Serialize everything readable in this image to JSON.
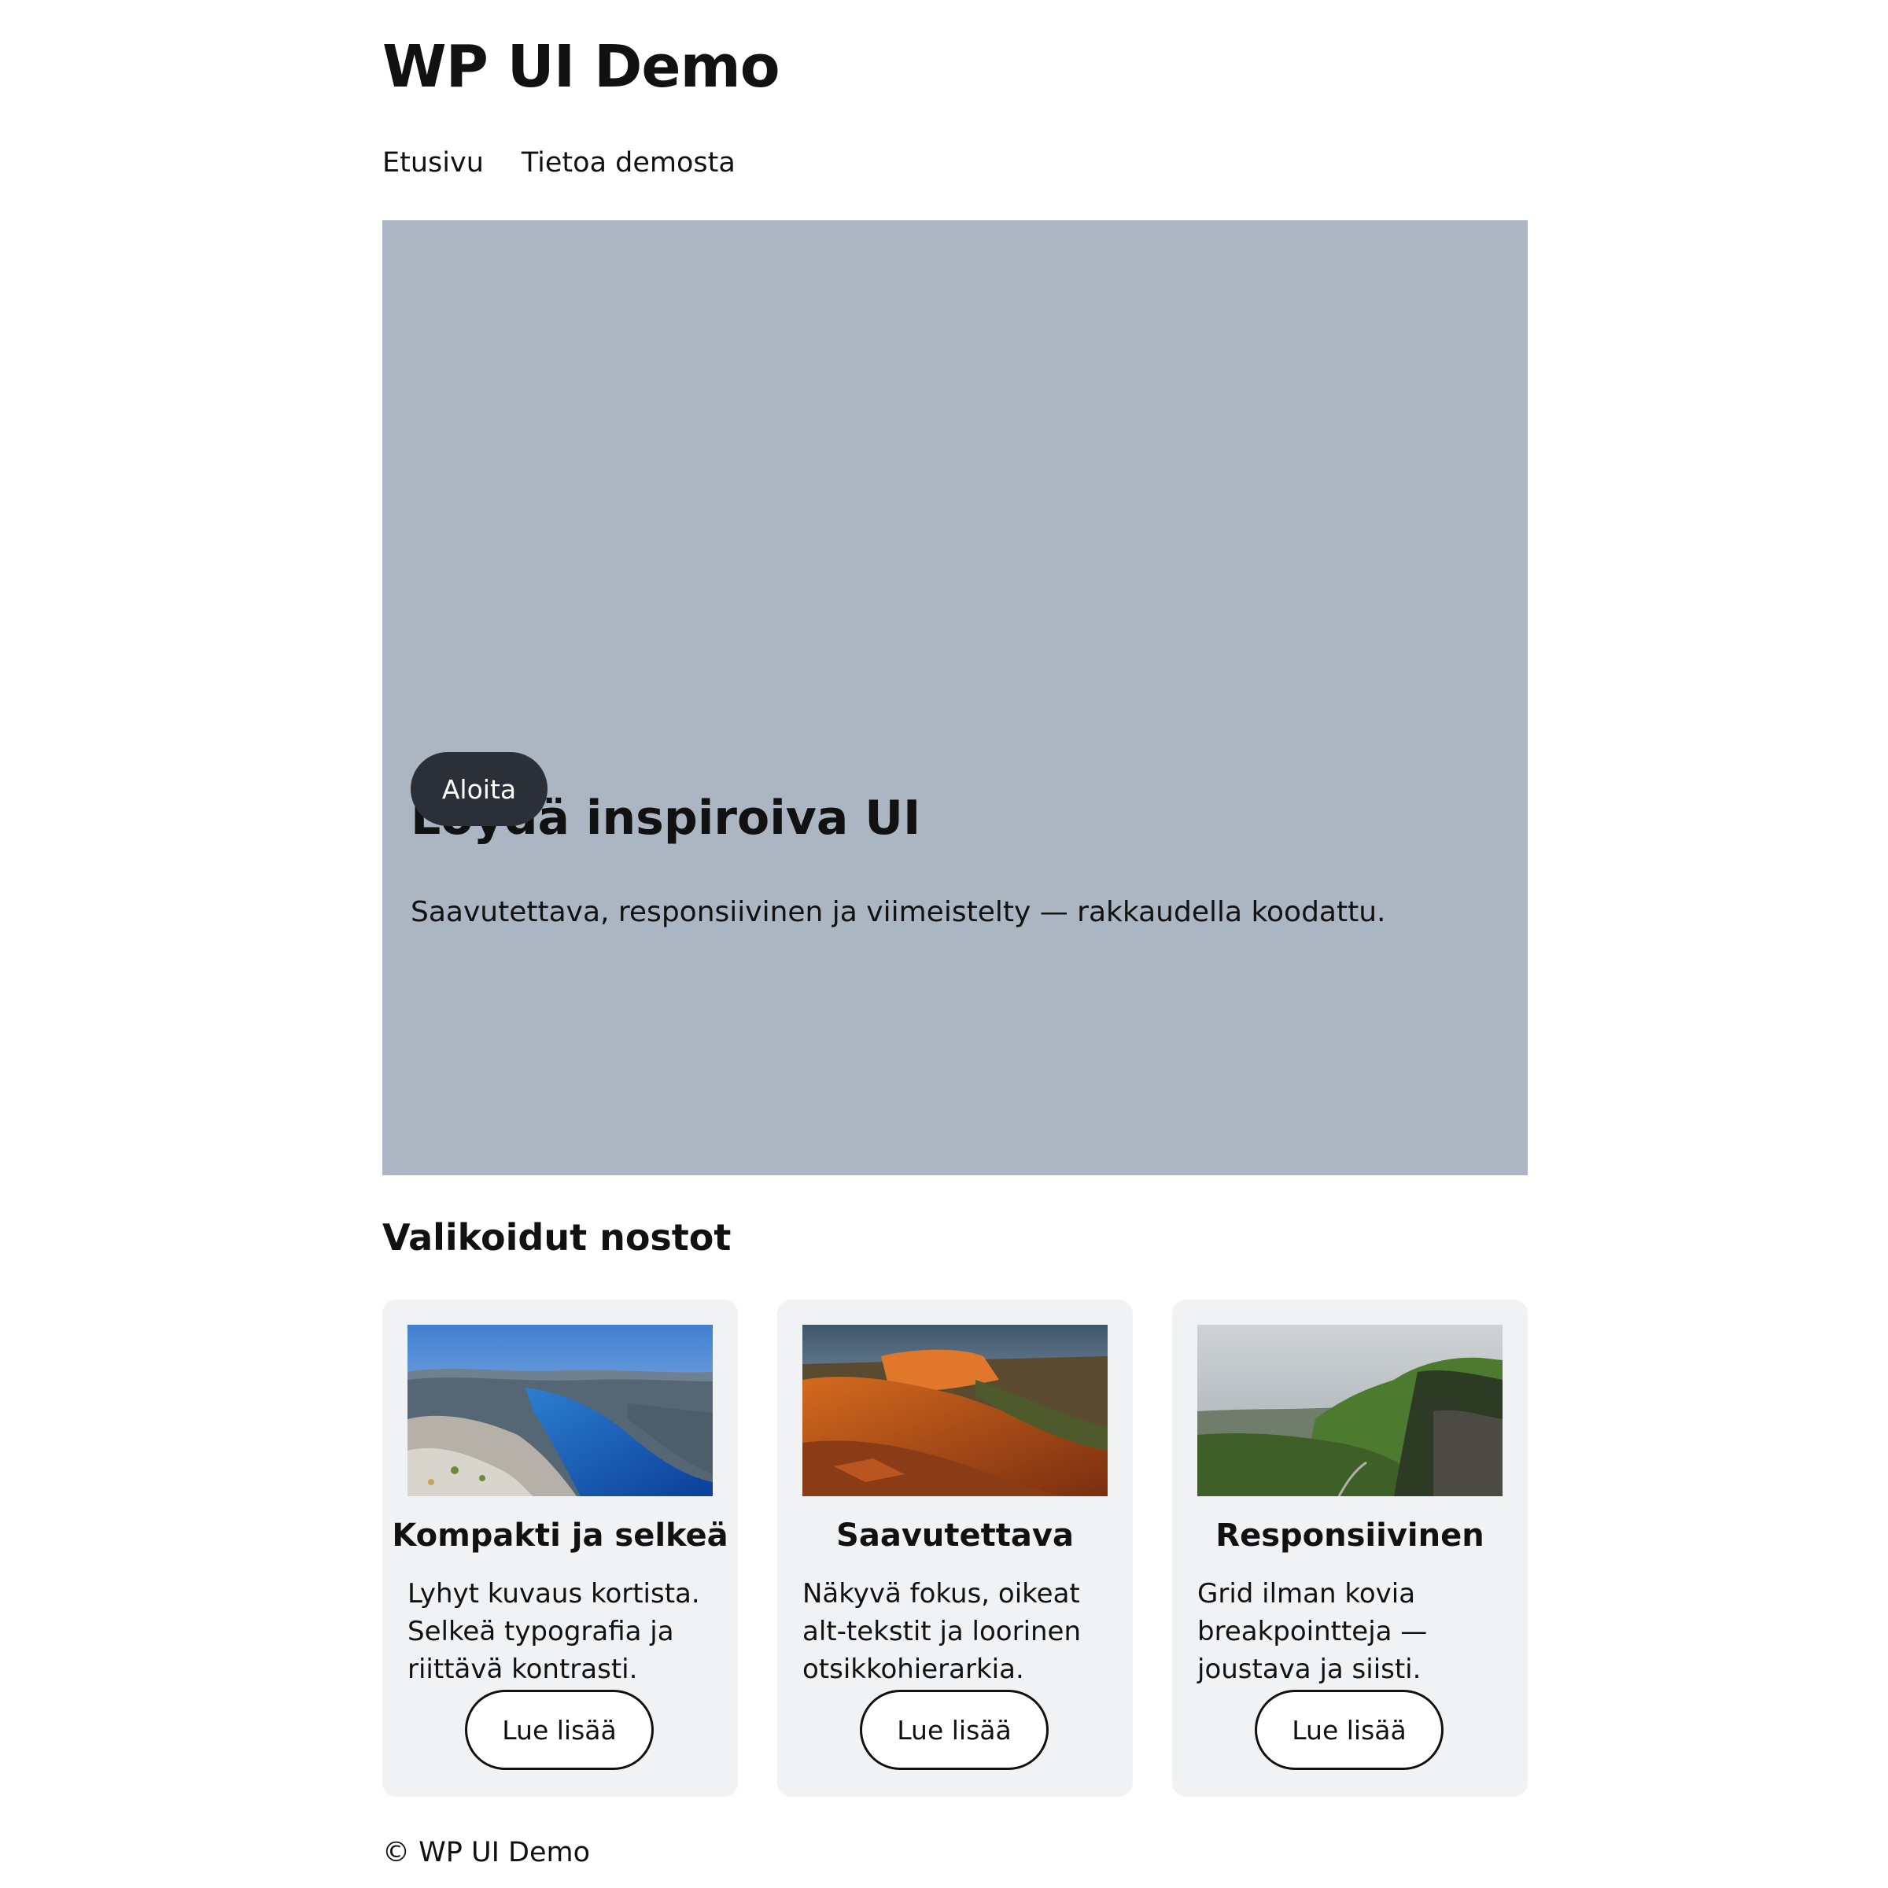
{
  "site": {
    "title": "WP UI Demo"
  },
  "nav": {
    "items": [
      {
        "label": "Etusivu"
      },
      {
        "label": "Tietoa demosta"
      }
    ]
  },
  "hero": {
    "heading": "Löydä inspiroiva UI",
    "text": "Saavutettava, responsiivinen ja viimeistelty — rakkaudella koodattu.",
    "button_label": "Aloita",
    "background_color": "#abb6c2",
    "button_color": "#2b3038"
  },
  "featured": {
    "title": "Valikoidut nostot",
    "cards": [
      {
        "title": "Kompakti ja selkeä",
        "text": "Lyhyt kuvaus kortista. Selkeä typografia ja riittävä kontrasti.",
        "button_label": "Lue lisää"
      },
      {
        "title": "Saavutettava",
        "text": "Näkyvä fokus, oikeat alt-tekstit ja loorinen otsikkohierarkia.",
        "button_label": "Lue lisää"
      },
      {
        "title": "Responsiivinen",
        "text": "Grid ilman kovia breakpointteja — joustava ja siisti.",
        "button_label": "Lue lisää"
      }
    ]
  },
  "footer": {
    "text": "© WP UI Demo"
  }
}
